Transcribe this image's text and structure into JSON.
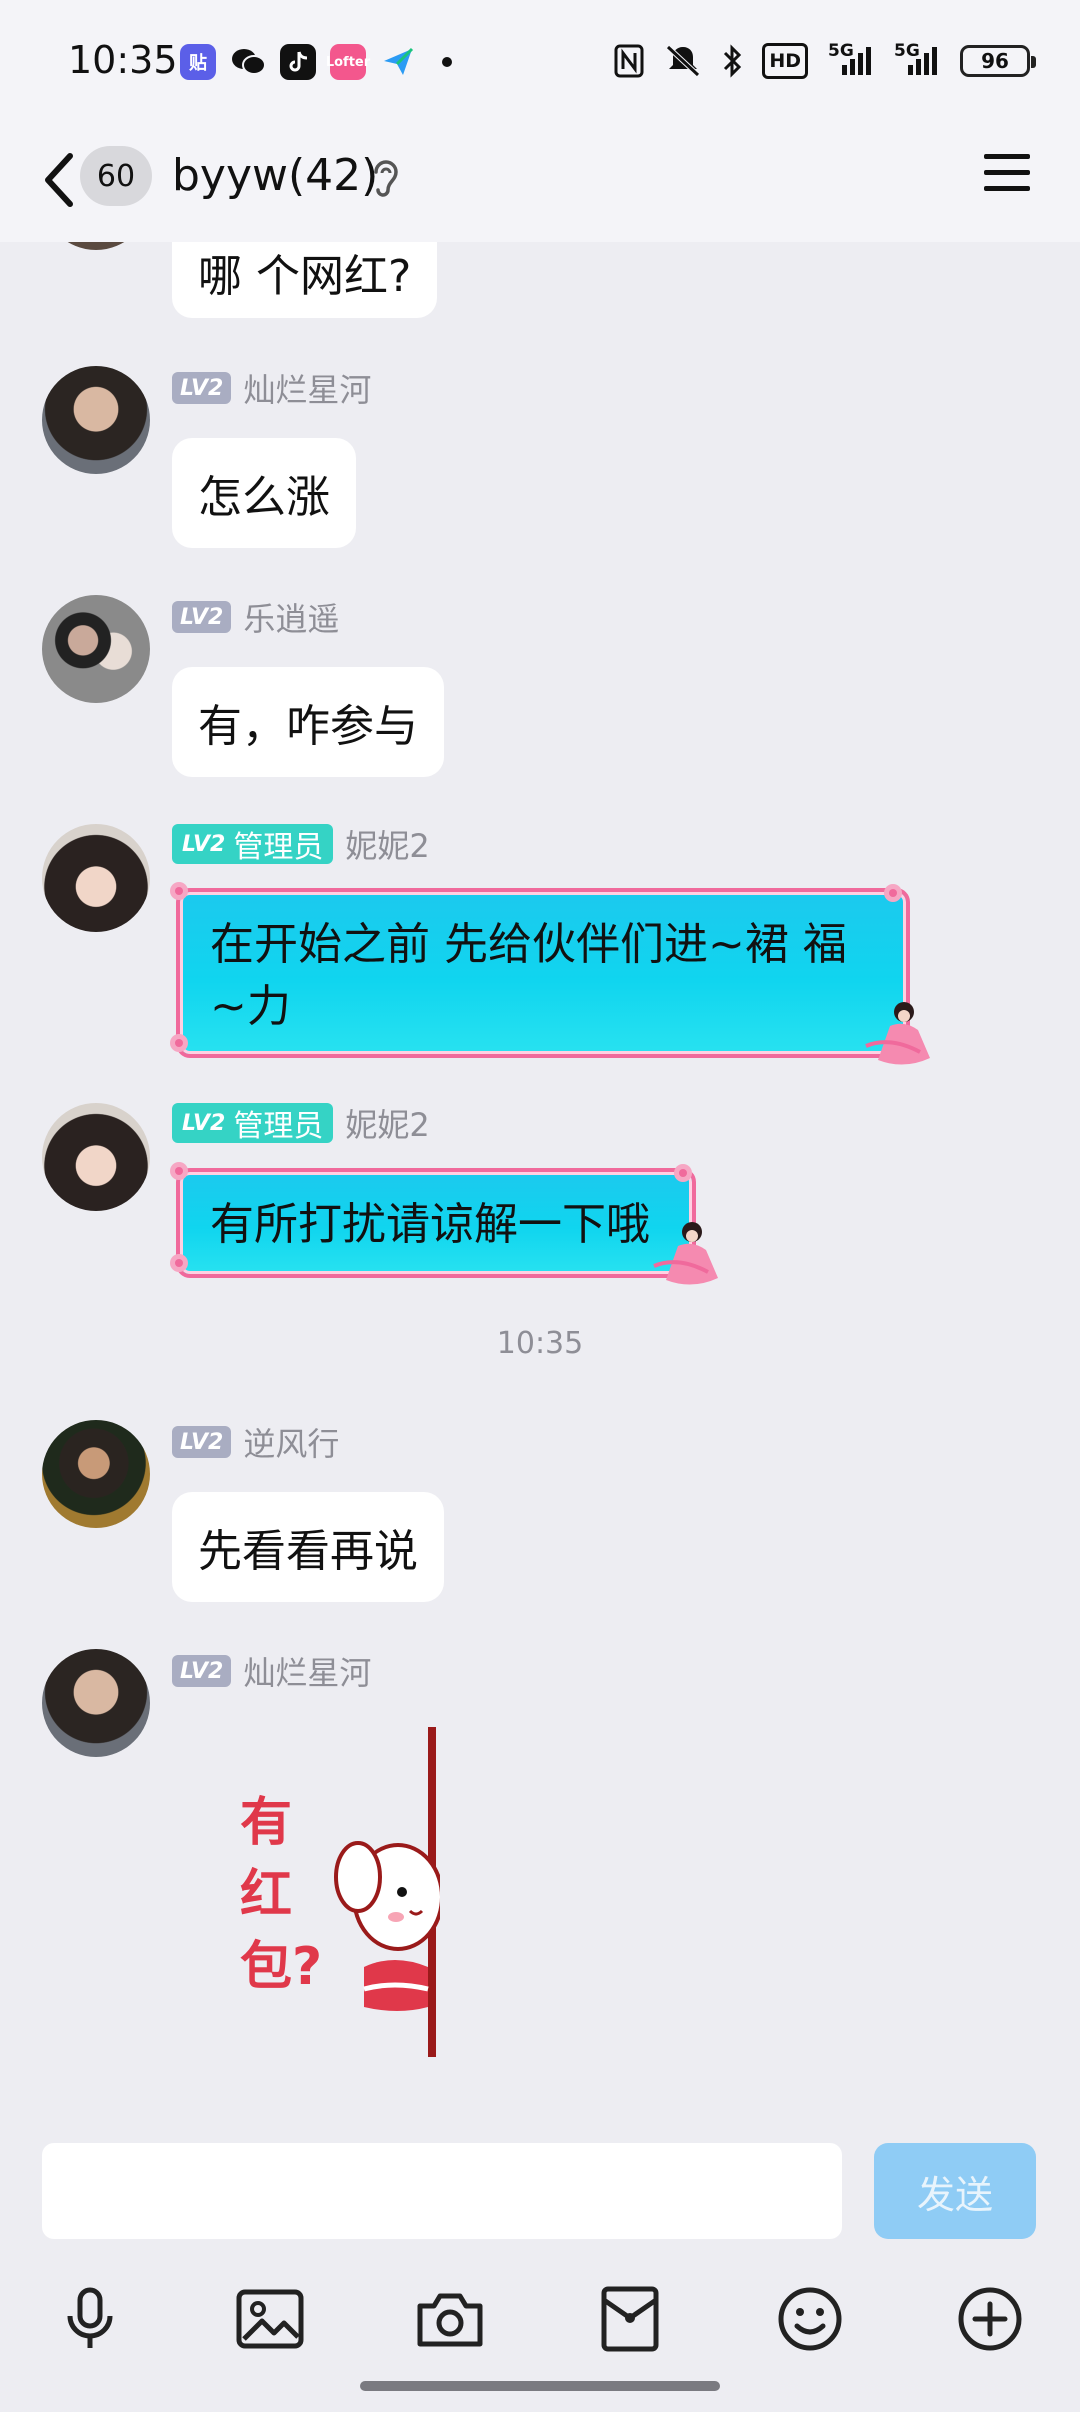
{
  "status_bar": {
    "time": "10:35",
    "app_icons": [
      "tieba-icon",
      "wechat-icon",
      "tiktok-icon",
      "bilibili-icon",
      "paper-plane-icon"
    ],
    "hd_label": "HD",
    "network_1": "5G",
    "network_2": "5G",
    "battery": "96"
  },
  "header": {
    "unread_count": "60",
    "title": "byyw(42)"
  },
  "messages": [
    {
      "type": "text",
      "text": "哪 个网红?"
    },
    {
      "type": "text",
      "level": "LV2",
      "nickname": "灿烂星河",
      "text": "怎么涨"
    },
    {
      "type": "text",
      "level": "LV2",
      "nickname": "乐逍遥",
      "text": "有，咋参与"
    },
    {
      "type": "fancy",
      "level": "LV2",
      "role": "管理员",
      "nickname": "妮妮2",
      "text": "在开始之前 先给伙伴们进~裙 福~力"
    },
    {
      "type": "fancy",
      "level": "LV2",
      "role": "管理员",
      "nickname": "妮妮2",
      "text": "有所打扰请谅解一下哦"
    },
    {
      "type": "time",
      "text": "10:35"
    },
    {
      "type": "text",
      "level": "LV2",
      "nickname": "逆风行",
      "text": "先看看再说"
    },
    {
      "type": "sticker",
      "level": "LV2",
      "nickname": "灿烂星河",
      "sticker_text": "有红包?"
    }
  ],
  "input": {
    "value": "",
    "send_label": "发送"
  },
  "toolbar": [
    "microphone-icon",
    "image-icon",
    "camera-icon",
    "red-packet-icon",
    "emoji-icon",
    "plus-icon"
  ],
  "colors": {
    "background": "#EDEDF2",
    "bubble": "#FFFFFF",
    "fancy_bubble": "#10D5EF",
    "fancy_border": "#F06A9C",
    "admin_badge": "#35D3C5",
    "level_badge": "#A9ADC2",
    "send_button": "#8FCCF5"
  }
}
